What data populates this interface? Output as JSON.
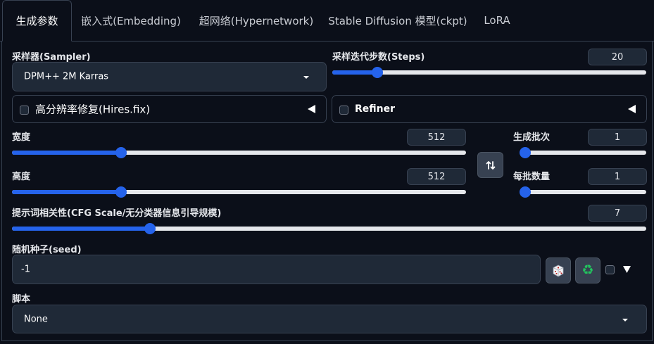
{
  "tabs": [
    {
      "label": "生成参数",
      "active": true
    },
    {
      "label": "嵌入式(Embedding)"
    },
    {
      "label": "超网络(Hypernetwork)"
    },
    {
      "label": "Stable Diffusion 模型(ckpt)"
    },
    {
      "label": "LoRA"
    }
  ],
  "sampler": {
    "label": "采样器(Sampler)",
    "value": "DPM++ 2M Karras"
  },
  "steps": {
    "label": "采样迭代步数(Steps)",
    "value": "20",
    "fraction": 0.13
  },
  "hires": {
    "label": "高分辨率修复(Hires.fix)",
    "checked": false
  },
  "refiner": {
    "label": "Refiner",
    "checked": false
  },
  "width": {
    "label": "宽度",
    "value": "512",
    "fraction": 0.233
  },
  "height": {
    "label": "高度",
    "value": "512",
    "fraction": 0.233
  },
  "batch_count": {
    "label": "生成批次",
    "value": "1",
    "fraction": 0.0
  },
  "batch_size": {
    "label": "每批数量",
    "value": "1",
    "fraction": 0.0
  },
  "swap_icon": "swap-arrows-icon",
  "cfg": {
    "label": "提示词相关性(CFG Scale/无分类器信息引导规模)",
    "value": "7",
    "fraction": 0.212
  },
  "seed": {
    "label": "随机种子(seed)",
    "value": "-1",
    "random_icon": "dice-icon",
    "reuse_icon": "recycle-icon"
  },
  "script": {
    "label": "脚本",
    "value": "None"
  },
  "colors": {
    "accent": "#2563eb",
    "background": "#0b0f19",
    "input": "#1f2937",
    "border": "#374151"
  }
}
